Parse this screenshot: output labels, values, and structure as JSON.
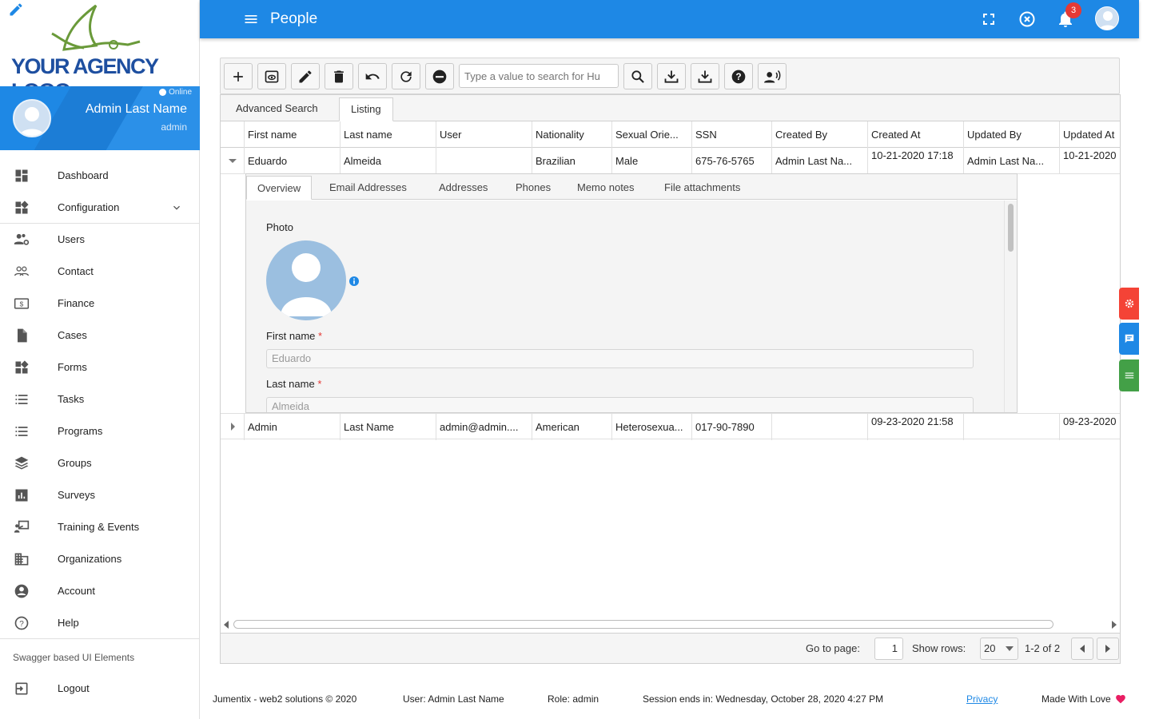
{
  "brand": {
    "logo_text": "YOUR AGENCY LOGO"
  },
  "user_card": {
    "status": "Online",
    "name": "Admin Last Name",
    "role": "admin"
  },
  "sidebar": {
    "items": [
      {
        "label": "Dashboard",
        "icon": "dashboard-icon"
      },
      {
        "label": "Configuration",
        "icon": "widgets-icon"
      },
      {
        "label": "Users",
        "icon": "users-gear-icon"
      },
      {
        "label": "Contact",
        "icon": "contact-icon"
      },
      {
        "label": "Finance",
        "icon": "dollar-icon"
      },
      {
        "label": "Cases",
        "icon": "file-icon"
      },
      {
        "label": "Forms",
        "icon": "widgets-icon"
      },
      {
        "label": "Tasks",
        "icon": "list-icon"
      },
      {
        "label": "Programs",
        "icon": "list-icon"
      },
      {
        "label": "Groups",
        "icon": "layers-icon"
      },
      {
        "label": "Surveys",
        "icon": "chart-icon"
      },
      {
        "label": "Training & Events",
        "icon": "presentation-icon"
      },
      {
        "label": "Organizations",
        "icon": "building-icon"
      },
      {
        "label": "Account",
        "icon": "account-icon"
      },
      {
        "label": "Help",
        "icon": "help-icon"
      }
    ],
    "section_title": "Swagger based UI Elements",
    "logout_label": "Logout"
  },
  "topbar": {
    "title": "People",
    "notification_count": "3"
  },
  "toolbar": {
    "search_placeholder": "Type a value to search for Hu"
  },
  "tabs": [
    "Advanced Search",
    "Listing"
  ],
  "grid": {
    "columns": [
      "First name",
      "Last name",
      "User",
      "Nationality",
      "Sexual Orie...",
      "SSN",
      "Created By",
      "Created At",
      "Updated By",
      "Updated At"
    ],
    "rows": [
      [
        "Eduardo",
        "Almeida",
        "",
        "Brazilian",
        "Male",
        "675-76-5765",
        "Admin Last Na...",
        "10-21-2020 17:18",
        "Admin Last Na...",
        "10-21-2020"
      ],
      [
        "Admin",
        "Last Name",
        "admin@admin....",
        "American",
        "Heterosexua...",
        "017-90-7890",
        "",
        "09-23-2020 21:58",
        "",
        "09-23-2020"
      ]
    ]
  },
  "detail": {
    "tabs": [
      "Overview",
      "Email Addresses",
      "Addresses",
      "Phones",
      "Memo notes",
      "File attachments"
    ],
    "photo_label": "Photo",
    "first_name_label": "First name",
    "first_name_value": "Eduardo",
    "last_name_label": "Last name",
    "last_name_value": "Almeida",
    "required_mark": "*"
  },
  "pagination": {
    "goto_label": "Go to page:",
    "page": "1",
    "rows_label": "Show rows:",
    "rows": "20",
    "range": "1-2 of 2"
  },
  "footer": {
    "company": "Jumentix - web2 solutions © 2020",
    "user": "User: Admin Last Name",
    "role": "Role: admin",
    "session": "Session ends in: Wednesday, October 28, 2020 4:27 PM",
    "privacy": "Privacy",
    "love": "Made With Love"
  },
  "colors": {
    "primary": "#1e88e5",
    "danger": "#e53935",
    "success": "#43a047"
  }
}
